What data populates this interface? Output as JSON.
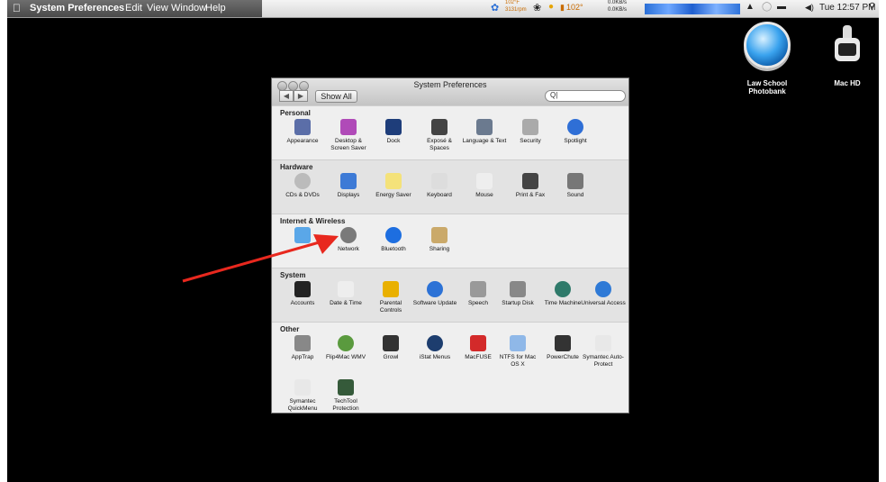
{
  "menubar": {
    "app_name": "System Preferences",
    "menus": [
      "Edit",
      "View",
      "Window",
      "Help"
    ],
    "status_temp_top": "102°F",
    "status_rate": "3131rpm",
    "status_temp": "102°",
    "net_up": "0.0KB/s",
    "net_down": "0.0KB/s",
    "clock": "Tue 12:57 PM"
  },
  "desktop": {
    "icons": [
      {
        "label": "Law School Photobank"
      },
      {
        "label": "Mac HD"
      }
    ]
  },
  "window": {
    "title": "System Preferences",
    "show_all": "Show All",
    "search_placeholder": "",
    "sections": [
      {
        "title": "Personal",
        "items": [
          {
            "label": "Appearance"
          },
          {
            "label": "Desktop & Screen Saver"
          },
          {
            "label": "Dock"
          },
          {
            "label": "Exposé & Spaces"
          },
          {
            "label": "Language & Text"
          },
          {
            "label": "Security"
          },
          {
            "label": "Spotlight"
          }
        ]
      },
      {
        "title": "Hardware",
        "items": [
          {
            "label": "CDs & DVDs"
          },
          {
            "label": "Displays"
          },
          {
            "label": "Energy Saver"
          },
          {
            "label": "Keyboard"
          },
          {
            "label": "Mouse"
          },
          {
            "label": "Print & Fax"
          },
          {
            "label": "Sound"
          }
        ]
      },
      {
        "title": "Internet & Wireless",
        "items": [
          {
            "label": ""
          },
          {
            "label": "Network"
          },
          {
            "label": "Bluetooth"
          },
          {
            "label": "Sharing"
          }
        ]
      },
      {
        "title": "System",
        "items": [
          {
            "label": "Accounts"
          },
          {
            "label": "Date & Time"
          },
          {
            "label": "Parental Controls"
          },
          {
            "label": "Software Update"
          },
          {
            "label": "Speech"
          },
          {
            "label": "Startup Disk"
          },
          {
            "label": "Time Machine"
          },
          {
            "label": "Universal Access"
          }
        ]
      },
      {
        "title": "Other",
        "items": [
          {
            "label": "AppTrap"
          },
          {
            "label": "Flip4Mac WMV"
          },
          {
            "label": "Growl"
          },
          {
            "label": "iStat Menus"
          },
          {
            "label": "MacFUSE"
          },
          {
            "label": "NTFS for Mac OS X"
          },
          {
            "label": "PowerChute"
          },
          {
            "label": "Symantec Auto-Protect"
          },
          {
            "label": "Symantec QuickMenu"
          },
          {
            "label": "TechTool Protection"
          }
        ]
      }
    ]
  },
  "annotation": {
    "arrow_color": "#e8281e"
  }
}
